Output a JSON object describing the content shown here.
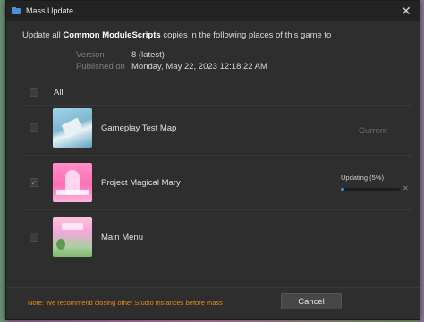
{
  "window": {
    "title": "Mass Update",
    "close_glyph": "✕"
  },
  "header": {
    "prefix": "Update all ",
    "package_name": "Common ModuleScripts",
    "suffix": " copies in the following places of this game to",
    "version_label": "Version",
    "version_value": "8 (latest)",
    "published_label": "Published on",
    "published_value": "Monday, May 22, 2023 12:18:22 AM"
  },
  "select_all": {
    "label": "All",
    "checked": false
  },
  "places": [
    {
      "name": "Gameplay Test Map",
      "status": "Current",
      "checked": false
    },
    {
      "name": "Project Magical Mary",
      "status": "Updating (5%)",
      "progress": 0.05,
      "checked": true
    },
    {
      "name": "Main Menu",
      "status": "",
      "checked": false
    }
  ],
  "footer": {
    "note": "Note: We recommend closing other Studio instances before mass",
    "cancel_label": "Cancel"
  },
  "colors": {
    "accent": "#3a8fe0",
    "warning": "#e88a1a",
    "background": "#2e2e2e"
  },
  "icons": {
    "window": "folder-icon",
    "close": "close-icon",
    "check": "checkmark-icon",
    "progress_cancel": "close-icon"
  }
}
